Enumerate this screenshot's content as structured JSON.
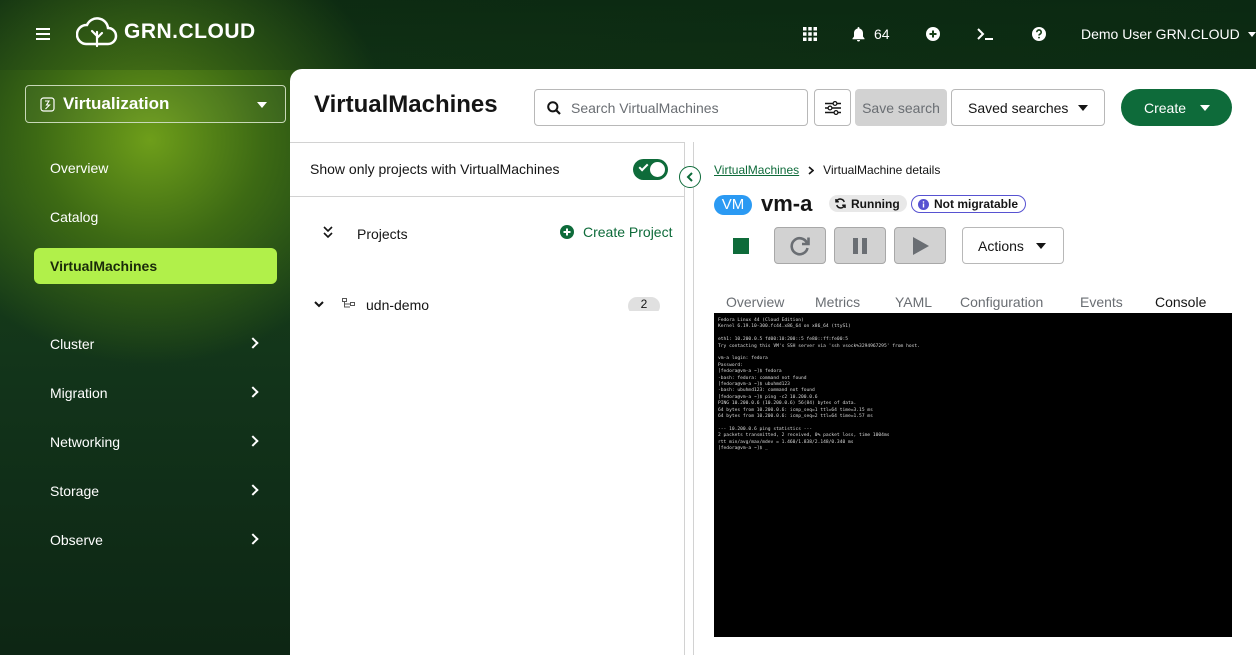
{
  "header": {
    "logo_text": "GRN.CLOUD",
    "notification_count": "64",
    "user_label": "Demo User GRN.CLOUD",
    "icons": [
      "hamburger-icon",
      "cloud-logo-icon",
      "app-grid-icon",
      "bell-icon",
      "plus-circle-icon",
      "terminal-icon",
      "help-icon",
      "caret-down-icon"
    ]
  },
  "sidebar": {
    "perspective": "Virtualization",
    "items": [
      {
        "label": "Overview"
      },
      {
        "label": "Catalog"
      },
      {
        "label": "VirtualMachines",
        "active": true
      },
      {
        "label": "Cluster",
        "expandable": true
      },
      {
        "label": "Migration",
        "expandable": true
      },
      {
        "label": "Networking",
        "expandable": true
      },
      {
        "label": "Storage",
        "expandable": true
      },
      {
        "label": "Observe",
        "expandable": true
      }
    ]
  },
  "main": {
    "title": "VirtualMachines",
    "search_placeholder": "Search VirtualMachines",
    "save_search_label": "Save search",
    "saved_searches_label": "Saved searches",
    "create_label": "Create"
  },
  "left_pane": {
    "show_only_label": "Show only projects with VirtualMachines",
    "toggle_on": true,
    "projects_label": "Projects",
    "create_project_label": "Create Project",
    "tree": [
      {
        "name": "udn-demo",
        "count": "2"
      }
    ]
  },
  "detail": {
    "breadcrumb_link": "VirtualMachines",
    "breadcrumb_current": "VirtualMachine details",
    "badge": "VM",
    "name": "vm-a",
    "status": "Running",
    "migration": "Not migratable",
    "actions_label": "Actions",
    "tabs": [
      "Overview",
      "Metrics",
      "YAML",
      "Configuration",
      "Events",
      "Console"
    ],
    "active_tab": "Console",
    "console_lines": [
      "Fedora Linux 44 (Cloud Edition)",
      "Kernel 6.19.10-300.fc44.x86_64 on x86_64 (ttyS1)",
      "",
      "eth1: 10.200.0.5 fd00:10:200::5 fe80::ff:fe00:5",
      "Try contacting this VM's SSH server via 'ssh vsock%3294967295' from host.",
      "",
      "vm-a login: fedora",
      "Password:",
      "[fedora@vm-a ~]$ fedora",
      "-bash: fedora: command not found",
      "[fedora@vm-a ~]$ ubuhmd123",
      "-bash: ubuhmd123: command not found",
      "[fedora@vm-a ~]$ ping -c2 10.200.0.6",
      "PING 10.200.0.6 (10.200.0.6) 56(84) bytes of data.",
      "64 bytes from 10.200.0.6: icmp_seq=1 ttl=64 time=3.15 ms",
      "64 bytes from 10.200.0.6: icmp_seq=2 ttl=64 time=1.57 ms",
      "",
      "--- 10.200.0.6 ping statistics ---",
      "2 packets transmitted, 2 received, 0% packet loss, time 1004ms",
      "rtt min/avg/max/mdev = 1.460/1.838/2.148/0.340 ms",
      "[fedora@vm-a ~]$ _"
    ]
  }
}
